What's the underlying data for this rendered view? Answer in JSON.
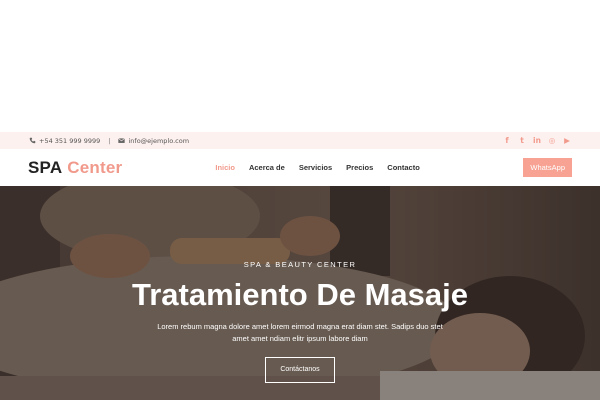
{
  "topbar": {
    "phone": "+54 351 999 9999",
    "separator": "|",
    "email": "info@ejemplo.com",
    "social": [
      {
        "icon": "facebook-icon",
        "glyph": "f"
      },
      {
        "icon": "twitter-icon",
        "glyph": "t"
      },
      {
        "icon": "linkedin-icon",
        "glyph": "in"
      },
      {
        "icon": "instagram-icon",
        "glyph": "◎"
      },
      {
        "icon": "youtube-icon",
        "glyph": "▶"
      }
    ]
  },
  "navbar": {
    "logo_part1": "SPA",
    "logo_part2": "Center",
    "menu": [
      "Inicio",
      "Acerca de",
      "Servicios",
      "Precios",
      "Contacto"
    ],
    "active_item": "Inicio",
    "whatsapp_label": "WhatsApp"
  },
  "hero": {
    "kicker": "SPA & BEAUTY CENTER",
    "title": "Tratamiento De Masaje",
    "description": "Lorem rebum magna dolore amet lorem eirmod magna erat diam stet. Sadips duo stet amet amet ndiam elitr ipsum labore diam",
    "cta_label": "Contáctanos"
  },
  "colors": {
    "accent": "#f19a8c",
    "topbar_bg": "#fdf1ef",
    "button_bg": "#f7a292"
  }
}
